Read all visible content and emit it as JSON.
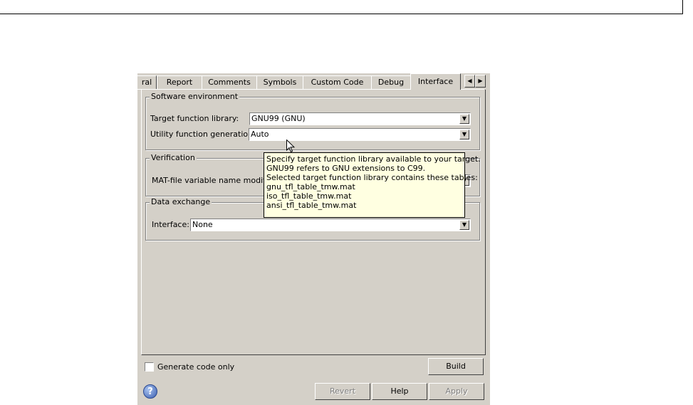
{
  "tabs": [
    {
      "label": "ral"
    },
    {
      "label": "Report"
    },
    {
      "label": "Comments"
    },
    {
      "label": "Symbols"
    },
    {
      "label": "Custom Code"
    },
    {
      "label": "Debug"
    },
    {
      "label": "Interface",
      "active": true
    }
  ],
  "software_env": {
    "title": "Software environment",
    "target_label": "Target function library:",
    "target_value": "GNU99 (GNU)",
    "utility_label": "Utility function generation:",
    "utility_value": "Auto"
  },
  "verification": {
    "title": "Verification",
    "mat_label": "MAT-file variable name modifi"
  },
  "data_exchange": {
    "title": "Data exchange",
    "interface_label": "Interface:",
    "interface_value": "None"
  },
  "tooltip": {
    "lines": [
      "Specify target function library available to your target.",
      "GNU99 refers to GNU extensions to C99.",
      "Selected target function library contains these tables:",
      "gnu_tfl_table_tmw.mat",
      "iso_tfl_table_tmw.mat",
      "ansi_tfl_table_tmw.mat"
    ]
  },
  "footer": {
    "generate_code_only": "Generate code only",
    "build": "Build",
    "revert": "Revert",
    "help": "Help",
    "apply": "Apply",
    "help_icon_glyph": "?"
  }
}
